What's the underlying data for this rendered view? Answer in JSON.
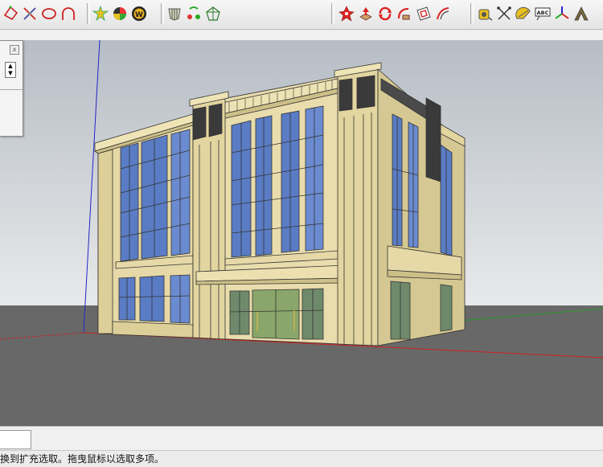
{
  "toolbar": {
    "groups": [
      {
        "name": "drawing-tools",
        "icons": [
          "rotated-rectangle-icon",
          "move-arrows-icon",
          "circle-icon",
          "arc-icon"
        ]
      },
      {
        "name": "styles-tools",
        "icons": [
          "sun-star-icon",
          "colorful-wheel-icon",
          "w-badge-icon"
        ]
      },
      {
        "name": "sandbox-tools",
        "icons": [
          "shield-mesh-icon",
          "paint-bucket-icon",
          "triangle-mesh-icon"
        ]
      },
      {
        "name": "plugin-tools",
        "icons": [
          "red-star-icon",
          "push-pull-icon",
          "orbit-refresh-icon",
          "follow-me-icon",
          "offset-icon",
          "fan-icon"
        ]
      },
      {
        "name": "construction-tools",
        "icons": [
          "tape-measure-icon",
          "dimension-icon",
          "protractor-icon",
          "text-label-icon",
          "axes-icon",
          "3d-text-icon"
        ]
      }
    ],
    "text_label_icon_text": "ABC"
  },
  "panel": {
    "close_glyph": "x"
  },
  "status_bar": {
    "text": "换到扩充选取。拖曳鼠标以选取多项。"
  },
  "measurements": {
    "value": ""
  },
  "colors": {
    "sky_top": "#b9c0c8",
    "sky_bottom": "#e6e8ea",
    "ground": "#686868",
    "wall": "#e8dcab",
    "wall_shadow": "#cdbf88",
    "glass": "#5a7cc4",
    "glass_light": "#9bb6e0",
    "red_axis": "#d02020",
    "green_axis": "#2a9a2a",
    "blue_axis": "#2020c0"
  }
}
